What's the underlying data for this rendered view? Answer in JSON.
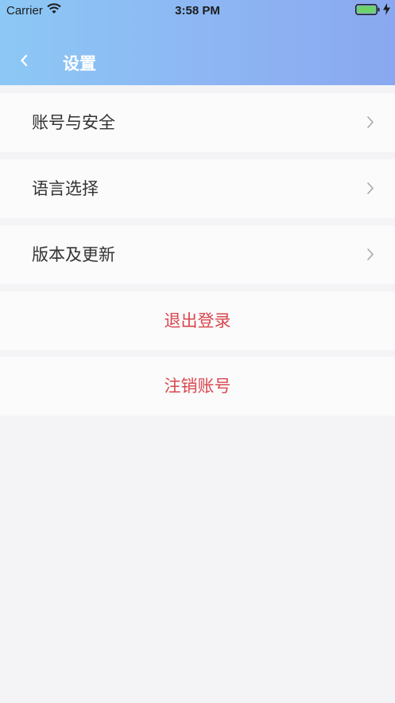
{
  "status_bar": {
    "carrier": "Carrier",
    "time": "3:58 PM",
    "wifi_icon": "wifi-icon",
    "battery_icon": "battery-icon",
    "battery_color": "#6cd36a"
  },
  "nav": {
    "title": "设置",
    "back_icon": "chevron-left-icon",
    "gradient": [
      "#8cc8f5",
      "#8aa8f0"
    ]
  },
  "settings": {
    "items": [
      {
        "label": "账号与安全",
        "icon": "chevron-right-icon"
      },
      {
        "label": "语言选择",
        "icon": "chevron-right-icon"
      },
      {
        "label": "版本及更新",
        "icon": "chevron-right-icon"
      }
    ],
    "actions": [
      {
        "label": "退出登录"
      },
      {
        "label": "注销账号"
      }
    ],
    "action_color": "#d9474f"
  }
}
